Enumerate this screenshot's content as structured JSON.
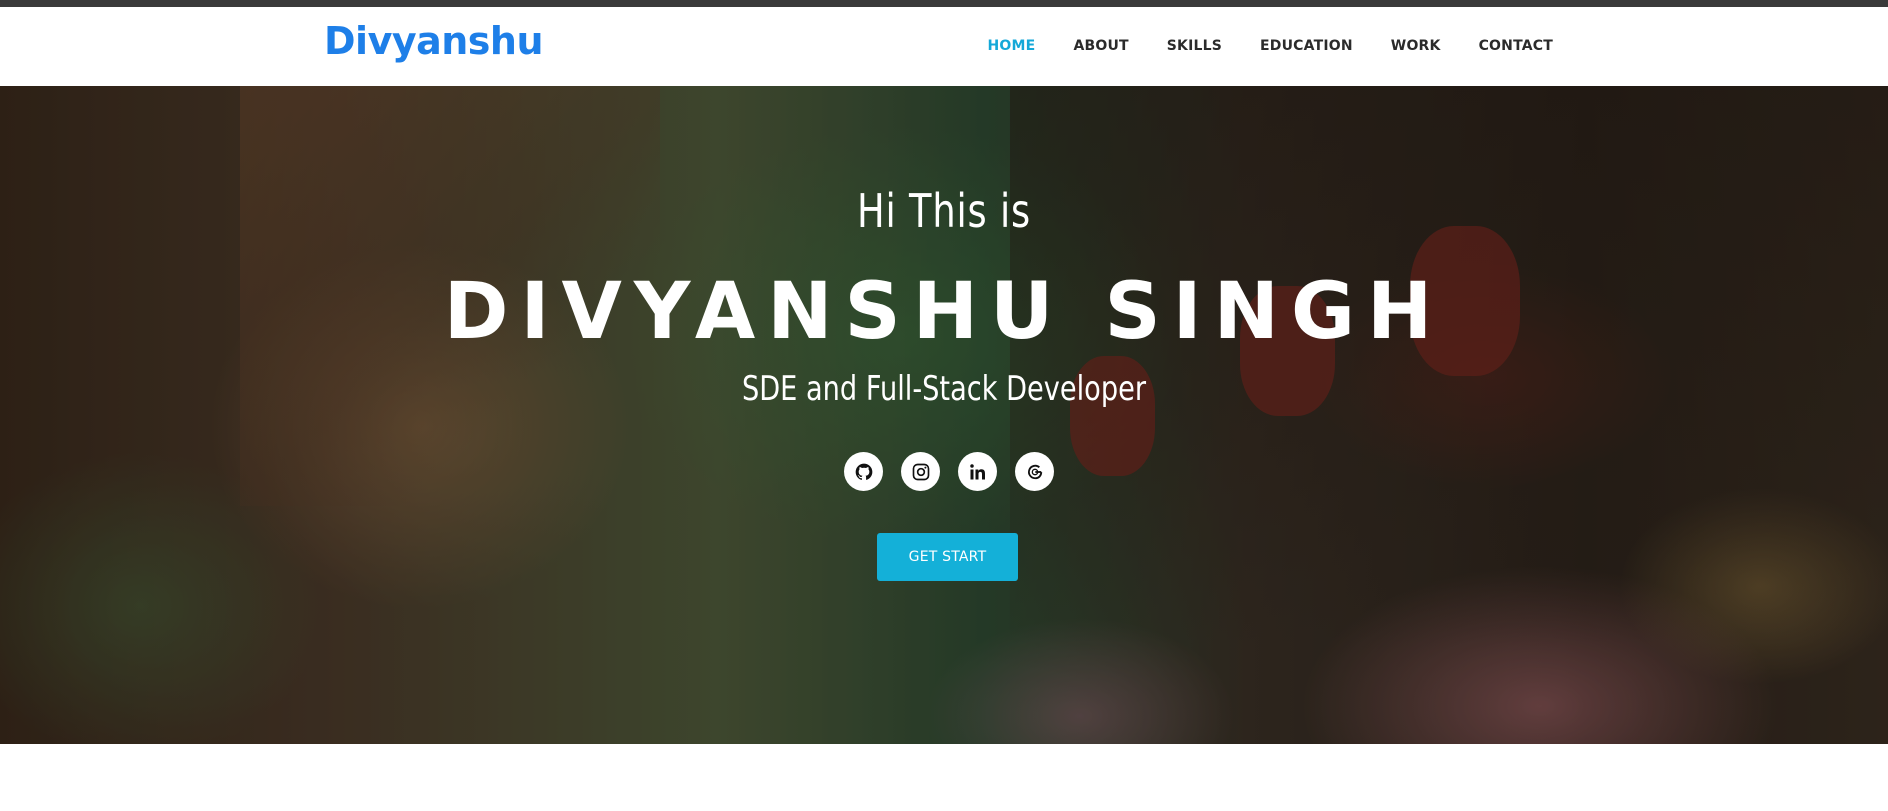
{
  "brand": "Divyanshu",
  "nav": {
    "items": [
      {
        "label": "HOME",
        "active": true
      },
      {
        "label": "ABOUT",
        "active": false
      },
      {
        "label": "SKILLS",
        "active": false
      },
      {
        "label": "EDUCATION",
        "active": false
      },
      {
        "label": "WORK",
        "active": false
      },
      {
        "label": "CONTACT",
        "active": false
      }
    ]
  },
  "hero": {
    "greeting": "Hi This is",
    "name": "DIVYANSHU SINGH",
    "role": "SDE and Full-Stack Developer",
    "socials": [
      {
        "icon": "github-icon"
      },
      {
        "icon": "instagram-icon"
      },
      {
        "icon": "linkedin-icon"
      },
      {
        "icon": "google-icon"
      }
    ],
    "cta_label": "GET START"
  },
  "colors": {
    "brand": "#1e7fe8",
    "nav_active": "#14a8d8",
    "cta": "#14b0d8",
    "nav_text": "#2b2b2b"
  }
}
